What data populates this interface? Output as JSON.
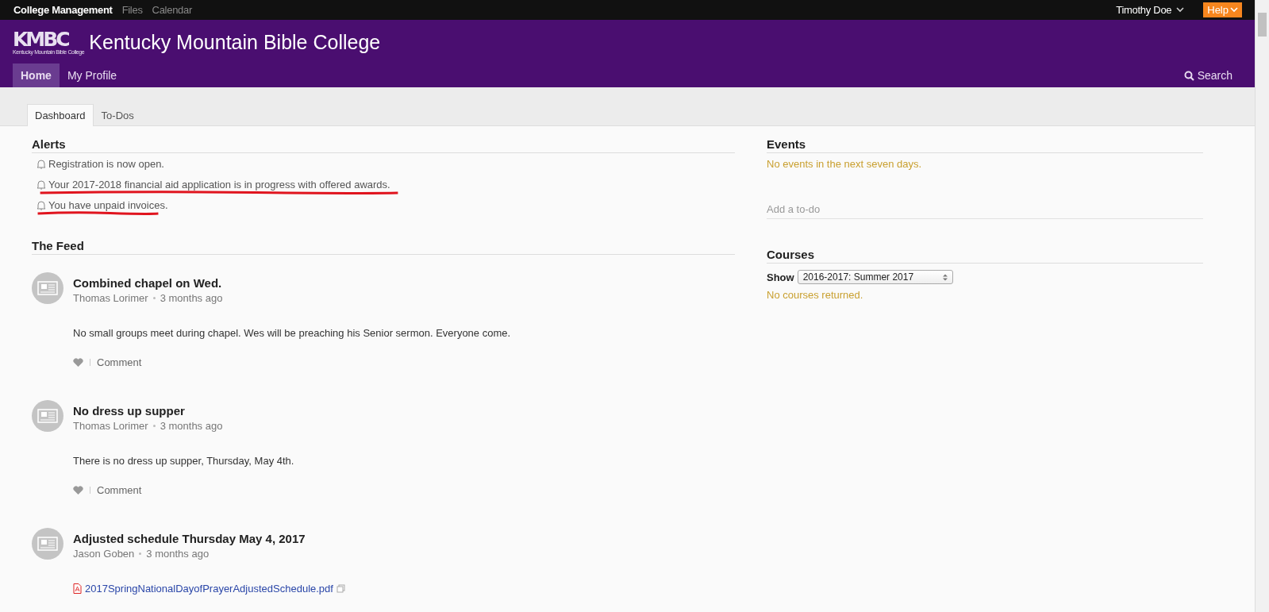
{
  "top_bar": {
    "links": [
      {
        "label": "College Management",
        "selected": true
      },
      {
        "label": "Files",
        "selected": false
      },
      {
        "label": "Calendar",
        "selected": false
      }
    ],
    "user": "Timothy Doe",
    "help": "Help"
  },
  "header": {
    "logo": {
      "mark": "KMBC",
      "tagline": "Kentucky Mountain Bible College"
    },
    "title": "Kentucky Mountain Bible College",
    "nav": [
      {
        "label": "Home",
        "selected": true
      },
      {
        "label": "My Profile",
        "selected": false
      }
    ],
    "search": "Search"
  },
  "tabs": [
    {
      "label": "Dashboard",
      "selected": true
    },
    {
      "label": "To-Dos",
      "selected": false
    }
  ],
  "alerts": {
    "title": "Alerts",
    "items": [
      {
        "text": "Registration is now open.",
        "marked": false
      },
      {
        "text": "Your 2017-2018 financial aid application is in progress with offered awards.",
        "marked": true
      },
      {
        "text": "You have unpaid invoices.",
        "marked": true
      }
    ]
  },
  "feed": {
    "title": "The Feed",
    "posts": [
      {
        "kind": "text",
        "title": "Combined chapel on Wed.",
        "author": "Thomas Lorimer",
        "time": "3 months ago",
        "body": "No small groups meet during chapel.  Wes will be preaching his Senior sermon.  Everyone come.",
        "comment": "Comment"
      },
      {
        "kind": "text",
        "title": "No dress up supper",
        "author": "Thomas Lorimer",
        "time": "3 months ago",
        "body": "There is no dress up supper, Thursday, May 4th.",
        "comment": "Comment"
      },
      {
        "kind": "file",
        "title": "Adjusted schedule Thursday May 4, 2017",
        "author": "Jason Goben",
        "time": "3 months ago",
        "body": "2017SpringNationalDayofPrayerAdjustedSchedule.pdf"
      }
    ]
  },
  "events": {
    "title": "Events",
    "empty": "No events in the next seven days."
  },
  "todo": {
    "placeholder": "Add a to-do"
  },
  "courses": {
    "title": "Courses",
    "show_label": "Show",
    "term": "2016-2017: Summer 2017",
    "empty": "No courses returned."
  }
}
